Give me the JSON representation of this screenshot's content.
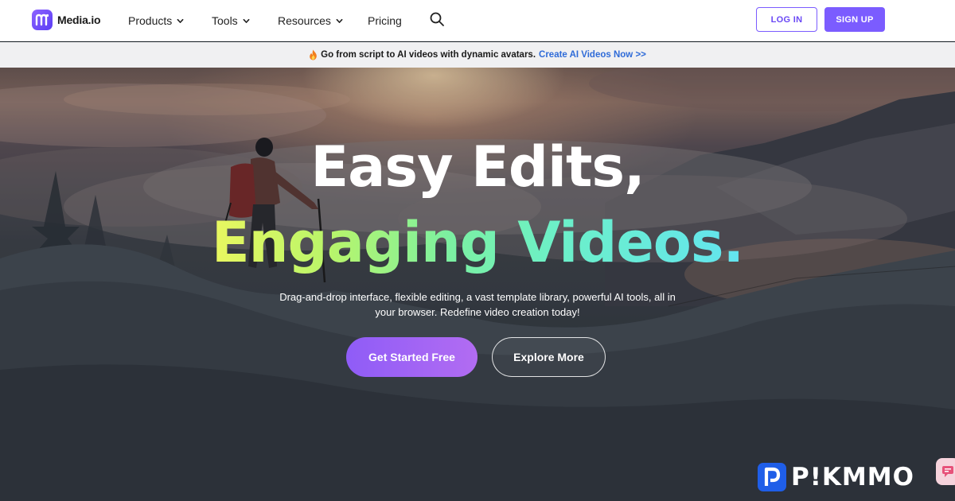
{
  "header": {
    "logo_text": "Media.io",
    "nav": [
      {
        "label": "Products"
      },
      {
        "label": "Tools"
      },
      {
        "label": "Resources"
      },
      {
        "label": "Pricing"
      }
    ],
    "login_label": "LOG IN",
    "signup_label": "SIGN UP"
  },
  "promo": {
    "icon": "fire-emoji",
    "text": "Go from script to AI videos with dynamic avatars.",
    "link": "Create AI Videos Now >>"
  },
  "hero": {
    "title_line1": "Easy Edits,",
    "title_line2": "Engaging Videos.",
    "subtitle": "Drag-and-drop interface, flexible editing, a vast template library, powerful AI tools, all in your browser. Redefine video creation today!",
    "primary_cta": "Get Started Free",
    "secondary_cta": "Explore More"
  },
  "watermark": {
    "text": "P!KMMO"
  },
  "colors": {
    "brand": "#7b5cff",
    "link": "#2f6bd8",
    "cta_gradient_start": "#8f5cf7",
    "cta_gradient_end": "#b26cf2"
  }
}
